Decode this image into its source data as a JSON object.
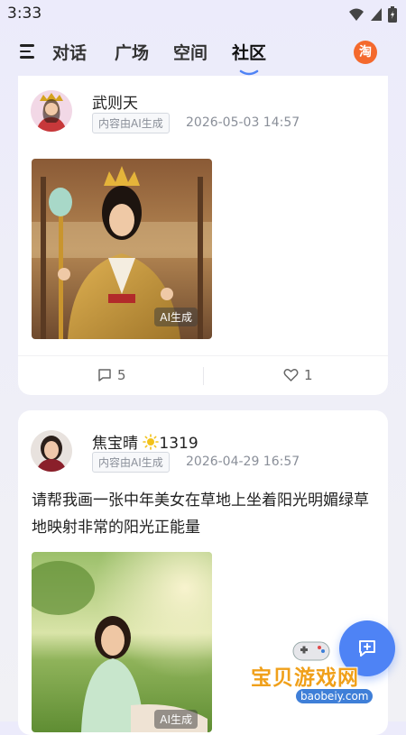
{
  "status_bar": {
    "time": "3:33"
  },
  "nav": {
    "tabs": [
      "对话",
      "广场",
      "空间",
      "社区"
    ],
    "active_tab": "社区",
    "taobao_label": "淘"
  },
  "posts": [
    {
      "username": "武则天",
      "ai_badge": "内容由AI生成",
      "time": "2026-05-03 14:57",
      "text": "",
      "image_tag": "AI生成",
      "comments": "5",
      "likes": "1"
    },
    {
      "username": "焦宝晴",
      "user_level": "1319",
      "ai_badge": "内容由AI生成",
      "time": "2026-04-29 16:57",
      "text": "请帮我画一张中年美女在草地上坐着阳光明媚绿草地映射非常的阳光正能量",
      "image_tag": "AI生成"
    }
  ],
  "watermark": {
    "title": "宝贝游戏网",
    "url": "baobeiy.com"
  },
  "colors": {
    "accent": "#4e83f5",
    "taobao": "#f4692d"
  }
}
